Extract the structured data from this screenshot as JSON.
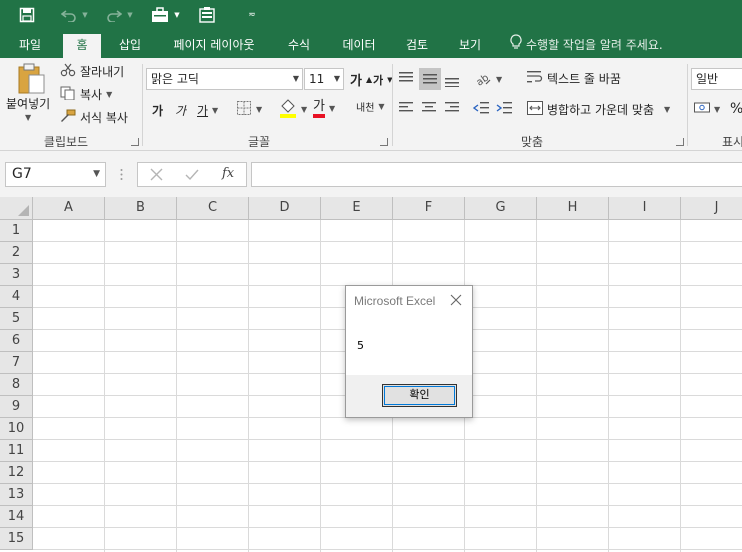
{
  "colors": {
    "brand": "#217346",
    "ribbon_bg": "#f3f3f3",
    "font_underline_red": "#e81123",
    "highlight_yellow": "#ffff00"
  },
  "title_bar": {
    "icons": [
      "save-icon",
      "undo-icon",
      "redo-icon",
      "briefcase-icon",
      "form-icon",
      "customize-qat-icon"
    ]
  },
  "tabs": [
    {
      "label": "파일"
    },
    {
      "label": "홈",
      "active": true
    },
    {
      "label": "삽입"
    },
    {
      "label": "페이지 레이아웃"
    },
    {
      "label": "수식"
    },
    {
      "label": "데이터"
    },
    {
      "label": "검토"
    },
    {
      "label": "보기"
    }
  ],
  "tell_me": {
    "placeholder": "수행할 작업을 알려 주세요."
  },
  "clipboard": {
    "paste_label": "붙여넣기",
    "cut_label": "잘라내기",
    "copy_label": "복사",
    "format_painter_label": "서식 복사",
    "group_label": "클립보드"
  },
  "font": {
    "font_name": "맑은 고딕",
    "font_size": "11",
    "grow_label": "가",
    "shrink_label": "가",
    "bold_label": "가",
    "italic_label": "가",
    "underline_label": "가",
    "font_color_label": "가",
    "phonetic_label": "내천",
    "group_label": "글꼴"
  },
  "alignment": {
    "wrap_text_label": "텍스트 줄 바꿈",
    "merge_center_label": "병합하고 가운데 맞춤",
    "group_label": "맞춤"
  },
  "number": {
    "format": "일반",
    "percent_label": "%",
    "group_label": "표시"
  },
  "formula_bar": {
    "name_box": "G7",
    "fx_label": "fx",
    "formula": ""
  },
  "grid": {
    "columns": [
      "A",
      "B",
      "C",
      "D",
      "E",
      "F",
      "G",
      "H",
      "I",
      "J"
    ],
    "rows": [
      "1",
      "2",
      "3",
      "4",
      "5",
      "6",
      "7",
      "8",
      "9",
      "10",
      "11",
      "12",
      "13",
      "14",
      "15"
    ]
  },
  "msgbox": {
    "title": "Microsoft Excel",
    "message": "5",
    "ok_label": "확인"
  }
}
